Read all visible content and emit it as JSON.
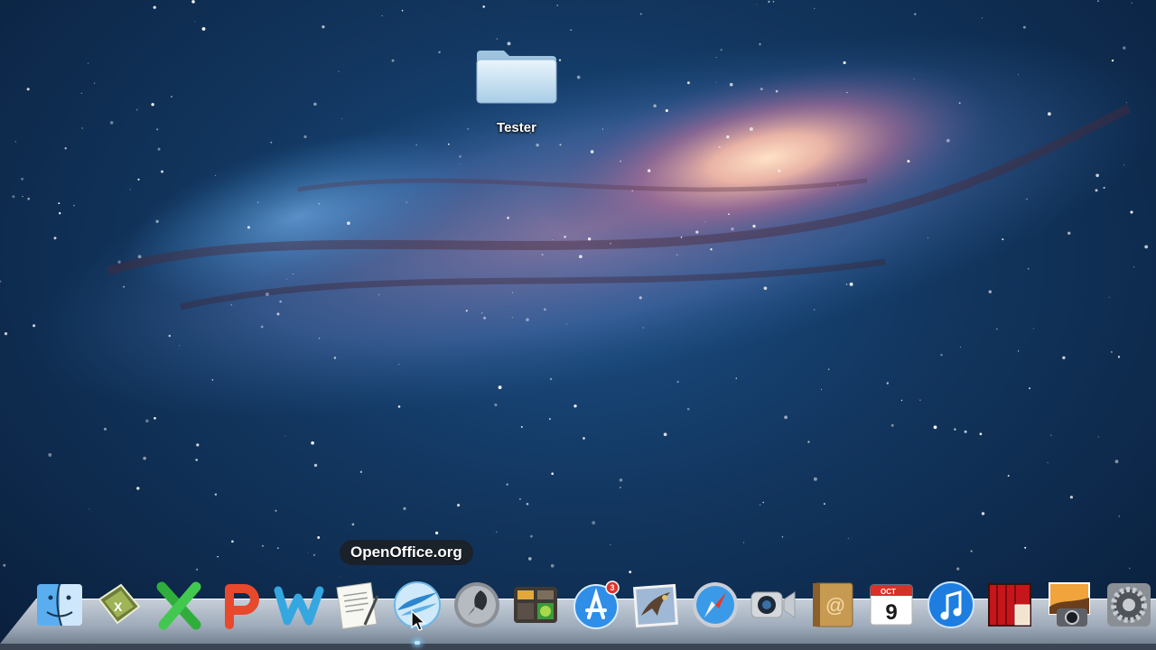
{
  "desktop": {
    "folder_label": "Tester"
  },
  "dock": {
    "tooltip": "OpenOffice.org",
    "calendar_month": "OCT",
    "calendar_day": "9",
    "app_store_badge": "3",
    "items": [
      {
        "icon": "finder-icon"
      },
      {
        "icon": "ms-excel-icon"
      },
      {
        "icon": "excel-x-icon"
      },
      {
        "icon": "powerpoint-p-icon"
      },
      {
        "icon": "word-w-icon"
      },
      {
        "icon": "textedit-icon"
      },
      {
        "icon": "openoffice-icon"
      },
      {
        "icon": "launchpad-icon"
      },
      {
        "icon": "dashboard-icon"
      },
      {
        "icon": "app-store-icon"
      },
      {
        "icon": "mail-icon"
      },
      {
        "icon": "safari-icon"
      },
      {
        "icon": "facetime-icon"
      },
      {
        "icon": "address-book-icon"
      },
      {
        "icon": "ical-icon"
      },
      {
        "icon": "itunes-icon"
      },
      {
        "icon": "photo-booth-icon"
      },
      {
        "icon": "iphoto-icon"
      },
      {
        "icon": "system-preferences-icon"
      }
    ]
  }
}
